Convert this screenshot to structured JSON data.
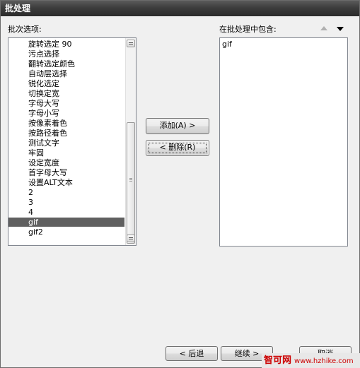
{
  "window": {
    "title": "批处理"
  },
  "left_panel": {
    "label": "批次选项:",
    "items": [
      "旋转选定 90",
      "污点选择",
      "翻转选定颜色",
      "自动层选择",
      "锐化选定",
      "切换定宽",
      "字母大写",
      "字母小写",
      "按像素着色",
      "按路径着色",
      "测试文字",
      "牢固",
      "设定宽度",
      "首字母大写",
      "设置ALT文本",
      "2",
      "3",
      "4",
      "gif",
      "gif2"
    ],
    "selected": "gif"
  },
  "right_panel": {
    "label": "在批处理中包含:",
    "items": [
      "gif"
    ]
  },
  "buttons": {
    "add": "添加(A) >",
    "remove": "< 删除(R)",
    "back": "< 后退",
    "next": "继续 >",
    "cancel": "取消"
  },
  "watermark": {
    "site": "智可网",
    "url": "www.hzhike.com"
  },
  "icons": {
    "move_up": "up-arrow-icon",
    "move_down": "down-arrow-icon"
  }
}
